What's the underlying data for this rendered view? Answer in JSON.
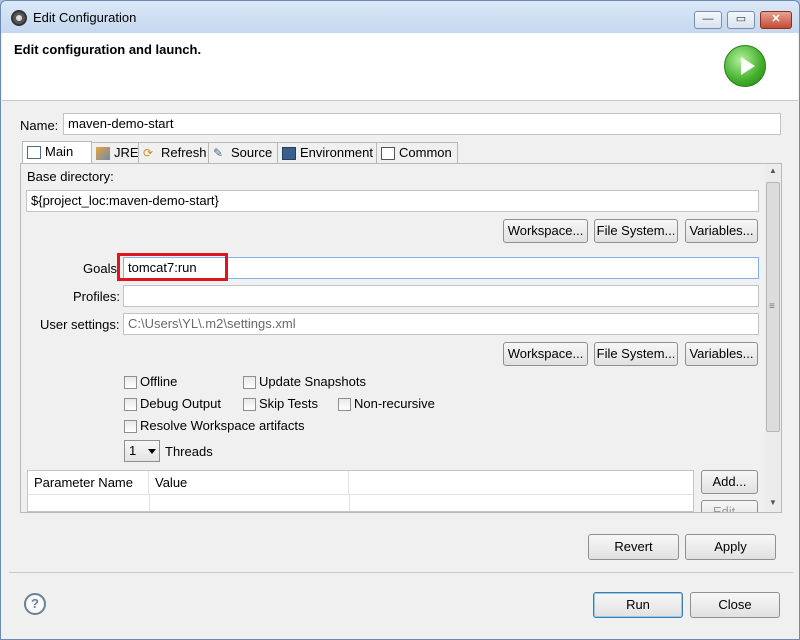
{
  "window": {
    "title": "Edit Configuration",
    "minimize": "—",
    "maximize": "▭",
    "close": "✕"
  },
  "header": {
    "text": "Edit configuration and launch."
  },
  "name": {
    "label": "Name:",
    "value": "maven-demo-start"
  },
  "tabs": [
    {
      "label": "Main",
      "icon": "main-tab-icon"
    },
    {
      "label": "JRE",
      "icon": "jre-icon"
    },
    {
      "label": "Refresh",
      "icon": "refresh-icon"
    },
    {
      "label": "Source",
      "icon": "source-icon"
    },
    {
      "label": "Environment",
      "icon": "environment-icon"
    },
    {
      "label": "Common",
      "icon": "common-icon"
    }
  ],
  "main": {
    "base_directory_label": "Base directory:",
    "base_directory_value": "${project_loc:maven-demo-start}",
    "workspace_btn": "Workspace...",
    "filesystem_btn": "File System...",
    "variables_btn": "Variables...",
    "goals_label": "Goals",
    "goals_value": "tomcat7:run",
    "profiles_label": "Profiles:",
    "profiles_value": "",
    "user_settings_label": "User settings:",
    "user_settings_value": "C:\\Users\\YL\\.m2\\settings.xml",
    "checkboxes": {
      "offline": "Offline",
      "update_snapshots": "Update Snapshots",
      "debug_output": "Debug Output",
      "skip_tests": "Skip Tests",
      "non_recursive": "Non-recursive",
      "resolve_workspace": "Resolve Workspace artifacts"
    },
    "threads_value": "1",
    "threads_label": "Threads",
    "table_headers": [
      "Parameter Name",
      "Value"
    ],
    "add_btn": "Add...",
    "edit_btn": "Edit..."
  },
  "buttons": {
    "revert": "Revert",
    "apply": "Apply",
    "run": "Run",
    "close": "Close",
    "help": "?"
  }
}
